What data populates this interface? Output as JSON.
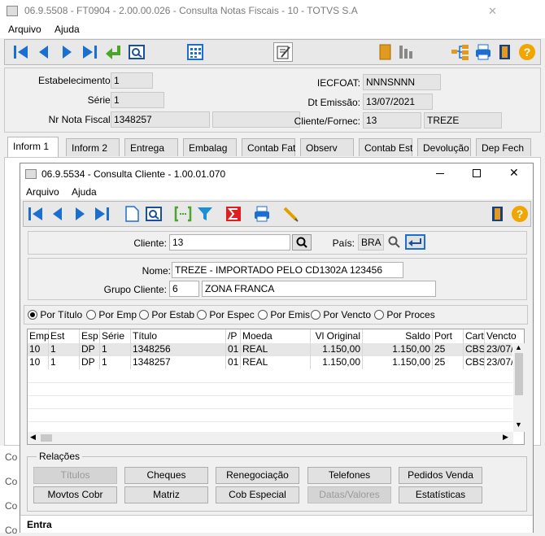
{
  "main_window": {
    "title": "06.9.5508 - FT0904 - 2.00.00.026 - Consulta Notas Fiscais - 10 - TOTVS S.A",
    "close_glyph": "✕",
    "menu": [
      "Arquivo",
      "Ajuda"
    ],
    "fields": {
      "estabelecimento_label": "Estabelecimento:",
      "estabelecimento": "1",
      "serie_label": "Série:",
      "serie": "1",
      "nr_nota_label": "Nr Nota Fiscal:",
      "nr_nota": "1348257",
      "iecfoat_label": "IECFOAT:",
      "iecfoat": "NNNSNNN",
      "dt_emissao_label": "Dt Emissão:",
      "dt_emissao": "13/07/2021",
      "cliente_label": "Cliente/Fornec:",
      "cliente_code": "13",
      "cliente_name": "TREZE"
    },
    "tabs": [
      "Inform 1",
      "Inform 2",
      "Entrega",
      "Embalag",
      "Contab Fat",
      "Observ",
      "Contab Est",
      "Devolução",
      "Dep Fech"
    ],
    "left_edge_text": [
      "Co",
      "Co",
      "Co",
      "Co"
    ]
  },
  "dialog": {
    "title": "06.9.5534 - Consulta Cliente - 1.00.01.070",
    "menu": [
      "Arquivo",
      "Ajuda"
    ],
    "cliente_label": "Cliente:",
    "cliente": "13",
    "pais_label": "País:",
    "pais": "BRA",
    "nome_label": "Nome:",
    "nome": "TREZE - IMPORTADO PELO CD1302A 123456",
    "grupo_label": "Grupo Cliente:",
    "grupo_code": "6",
    "grupo_name": "ZONA FRANCA",
    "radios": [
      {
        "label": "Por Título",
        "selected": true
      },
      {
        "label": "Por Emp",
        "selected": false
      },
      {
        "label": "Por Estab",
        "selected": false
      },
      {
        "label": "Por Espec",
        "selected": false
      },
      {
        "label": "Por Emis",
        "selected": false
      },
      {
        "label": "Por Vencto",
        "selected": false
      },
      {
        "label": "Por Proces",
        "selected": false
      }
    ],
    "columns": [
      "Emp",
      "Est",
      "Esp",
      "Série",
      "Título",
      "/P",
      "Moeda",
      "Vl Original",
      "Saldo",
      "Port",
      "Cart",
      "Vencto"
    ],
    "rows": [
      [
        "10",
        "1",
        "DP",
        "1",
        "1348256",
        "01",
        "REAL",
        "1.150,00",
        "1.150,00",
        "25",
        "CBS",
        "23/07/"
      ],
      [
        "10",
        "1",
        "DP",
        "1",
        "1348257",
        "01",
        "REAL",
        "1.150,00",
        "1.150,00",
        "25",
        "CBS",
        "23/07/"
      ]
    ],
    "relacoes_label": "Relações",
    "buttons": [
      "Títulos",
      "Cheques",
      "Renegociação",
      "Telefones",
      "Pedidos Venda",
      "Movtos Cobr",
      "Matriz",
      "Cob Especial",
      "Datas/Valores",
      "Estatísticas"
    ],
    "status": "Entra"
  }
}
